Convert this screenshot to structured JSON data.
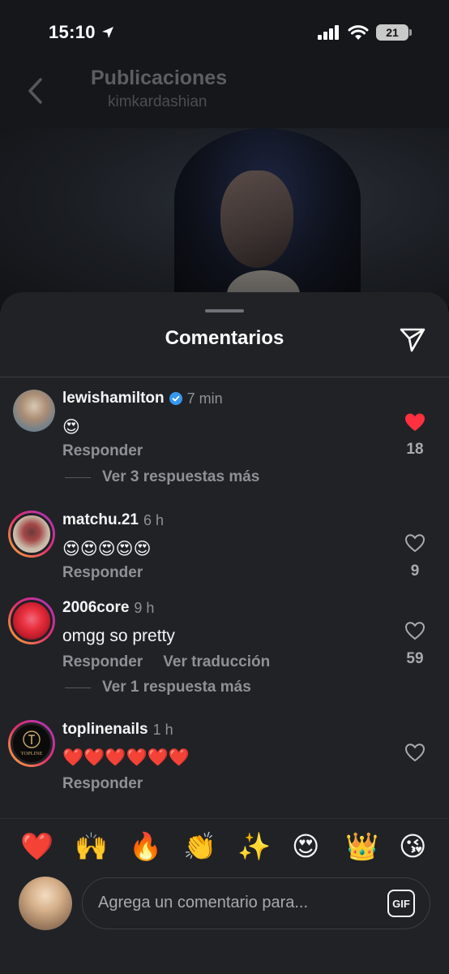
{
  "status_bar": {
    "time": "15:10",
    "battery": "21"
  },
  "nav": {
    "title": "Publicaciones",
    "subtitle": "kimkardashian"
  },
  "sheet": {
    "title": "Comentarios"
  },
  "comments": [
    {
      "username": "lewishamilton",
      "verified": true,
      "time": "7 min",
      "text": "😍",
      "reply_label": "Responder",
      "more_replies": "Ver 3 respuestas más",
      "liked": true,
      "likes": "18"
    },
    {
      "username": "matchu.21",
      "verified": false,
      "time": "6 h",
      "text": "😍😍😍😍😍",
      "reply_label": "Responder",
      "liked": false,
      "likes": "9"
    },
    {
      "username": "2006core",
      "verified": false,
      "time": "9 h",
      "text": "omgg so pretty",
      "reply_label": "Responder",
      "translate_label": "Ver traducción",
      "more_replies": "Ver 1 respuesta más",
      "liked": false,
      "likes": "59"
    },
    {
      "username": "toplinenails",
      "verified": false,
      "time": "1 h",
      "text": "❤️❤️❤️❤️❤️❤️",
      "reply_label": "Responder",
      "liked": false,
      "likes": "",
      "avatar_text": "TOPLINE"
    }
  ],
  "quick_emojis": [
    "❤️",
    "🙌",
    "🔥",
    "👏",
    "✨",
    "😍",
    "👑",
    "😘"
  ],
  "composer": {
    "placeholder": "Agrega un comentario para...",
    "gif_label": "GIF"
  },
  "colors": {
    "like_red": "#ff3040",
    "verified_blue": "#3897f0",
    "sheet_bg": "#202226"
  }
}
